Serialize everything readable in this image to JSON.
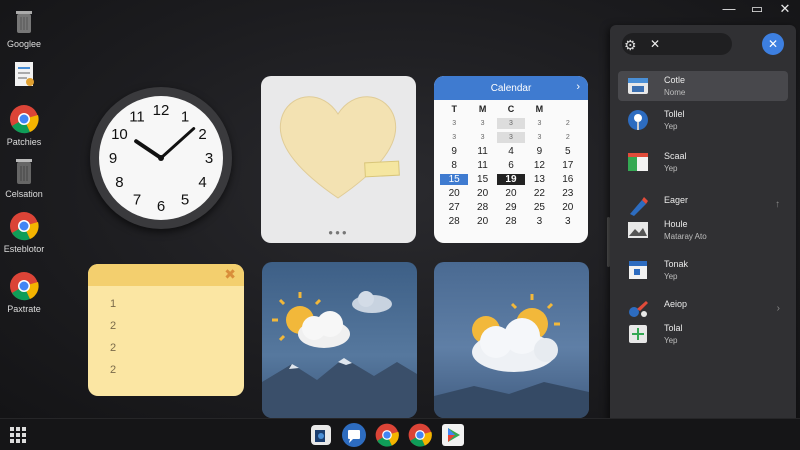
{
  "window_controls": {
    "minimize": "—",
    "maximize": "▭",
    "close": "✕"
  },
  "desktop_icons": [
    {
      "label": "Googlee",
      "icon": "trash-icon"
    },
    {
      "label": "",
      "icon": "document-icon"
    },
    {
      "label": "Patchies",
      "icon": "chrome-icon"
    },
    {
      "label": "Celsation",
      "icon": "trash-icon"
    },
    {
      "label": "Esteblotor",
      "icon": "chrome-icon"
    },
    {
      "label": "Paxtrate",
      "icon": "chrome-icon"
    }
  ],
  "clock": {
    "numbers": [
      "12",
      "1",
      "2",
      "3",
      "4",
      "5",
      "6",
      "7",
      "8",
      "9",
      "10",
      "11"
    ],
    "hour": 10,
    "minute": 8
  },
  "calendar": {
    "title": "Calendar",
    "chevron": "›",
    "headers": [
      "T",
      "M",
      "C",
      "M",
      ""
    ],
    "cells": [
      "3",
      "3",
      "3",
      "3",
      "2",
      "3",
      "3",
      "3",
      "3",
      "2",
      "9",
      "11",
      "4",
      "9",
      "5",
      "8",
      "11",
      "6",
      "12",
      "17",
      "15",
      "15",
      "19",
      "13",
      "16",
      "20",
      "20",
      "20",
      "22",
      "23",
      "27",
      "28",
      "29",
      "25",
      "20",
      "28",
      "20",
      "28",
      "3",
      "3"
    ],
    "today": "15",
    "marked": "19"
  },
  "note": {
    "close": "✖",
    "items": [
      "1",
      "2",
      "2",
      "2"
    ]
  },
  "taskbar": {
    "apps_icon": "app-launcher-icon",
    "pinned": [
      "camera-icon",
      "chat-icon",
      "chrome-icon",
      "chrome-icon",
      "play-store-icon"
    ]
  },
  "panel": {
    "close": "✕",
    "search_x": "✕",
    "items": [
      {
        "line1": "Cotle",
        "line2": "Nome",
        "icon": "store-icon",
        "selected": true,
        "arrow": ""
      },
      {
        "line1": "Tollel",
        "line2": "Yep",
        "icon": "globe-icon",
        "selected": false,
        "arrow": ""
      },
      {
        "line1": "Scaal",
        "line2": "Yep",
        "icon": "calendar-icon",
        "selected": false,
        "arrow": ""
      },
      {
        "line1": "Eager",
        "line2": "",
        "icon": "pen-icon",
        "selected": false,
        "arrow": "↑"
      },
      {
        "line1": "Houle",
        "line2": "Mataray Ato",
        "icon": "image-icon",
        "selected": false,
        "arrow": ""
      },
      {
        "line1": "Tonak",
        "line2": "Yep",
        "icon": "calendar-small-icon",
        "selected": false,
        "arrow": ""
      },
      {
        "line1": "Aeiop",
        "line2": "",
        "icon": "tools-icon",
        "selected": false,
        "arrow": "›"
      },
      {
        "line1": "Tolal",
        "line2": "Yep",
        "icon": "plus-icon",
        "selected": false,
        "arrow": ""
      }
    ]
  },
  "colors": {
    "accent": "#3f7bd0",
    "panel_bg": "#303033",
    "note_bg": "#fbe6a3"
  }
}
